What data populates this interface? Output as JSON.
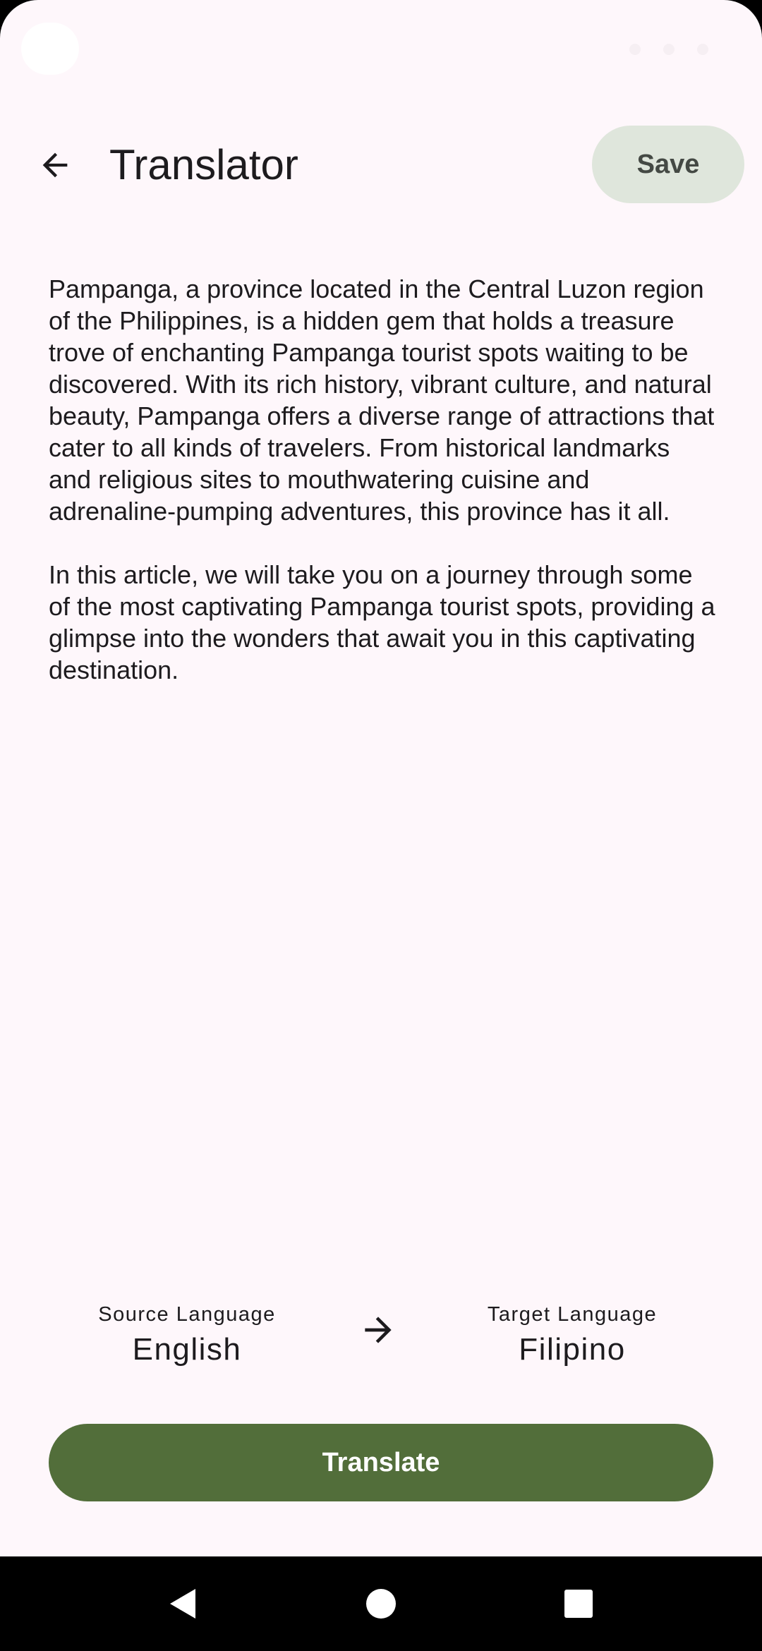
{
  "header": {
    "title": "Translator",
    "save_label": "Save",
    "back_icon": "arrow-back-icon"
  },
  "article": {
    "paragraphs": [
      "Pampanga, a province located in the Central Luzon region of the Philippines, is a hidden gem that holds a treasure trove of enchanting Pampanga tourist spots waiting to be discovered. With its rich history, vibrant culture, and natural beauty, Pampanga offers a diverse range of attractions that cater to all kinds of travelers. From historical landmarks and religious sites to mouthwatering cuisine and adrenaline-pumping adventures, this province has it all.",
      "In this article, we will take you on a journey through some of the most captivating Pampanga tourist spots, providing a glimpse into the wonders that await you in this captivating destination."
    ]
  },
  "languages": {
    "source_caption": "Source Language",
    "source_value": "English",
    "target_caption": "Target Language",
    "target_value": "Filipino",
    "swap_icon": "arrow-forward-icon"
  },
  "actions": {
    "translate_label": "Translate"
  },
  "colors": {
    "background": "#fef7fb",
    "primary": "#526e3a",
    "save_button": "#dfe6dc",
    "text": "#1d1b1e"
  }
}
